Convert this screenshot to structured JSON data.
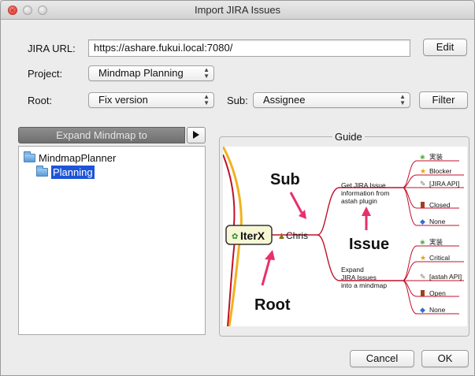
{
  "window": {
    "title": "Import JIRA Issues"
  },
  "form": {
    "jira_url_label": "JIRA URL:",
    "jira_url_value": "https://ashare.fukui.local:7080/",
    "edit_label": "Edit",
    "project_label": "Project:",
    "project_value": "Mindmap Planning",
    "root_label": "Root:",
    "root_value": "Fix version",
    "sub_label": "Sub:",
    "sub_value": "Assignee",
    "filter_label": "Filter"
  },
  "expand": {
    "label": "Expand Mindmap to"
  },
  "tree": {
    "root_label": "MindmapPlanner",
    "child_label": "Planning"
  },
  "guide": {
    "legend": "Guide",
    "sub": "Sub",
    "root": "Root",
    "issue": "Issue",
    "iterx": "IterX",
    "chris": "Chris",
    "get_info_1": "Get JIRA Issue",
    "get_info_2": "information from",
    "get_info_3": "astah plugin",
    "expand_1": "Expand",
    "expand_2": "JIRA Issues",
    "expand_3": "into a mindmap",
    "tags_top": [
      "実装",
      "Blocker",
      "[JIRA API]",
      "Closed",
      "None"
    ],
    "tags_bottom": [
      "実装",
      "Critical",
      "[astah API]",
      "Open",
      "None"
    ]
  },
  "footer": {
    "cancel_label": "Cancel",
    "ok_label": "OK"
  }
}
